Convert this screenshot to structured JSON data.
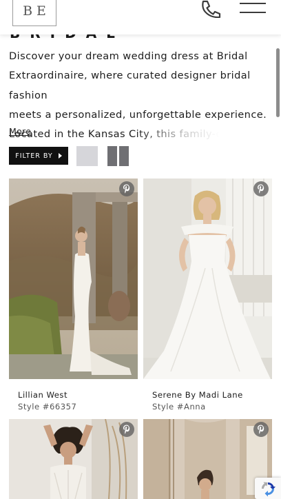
{
  "header": {
    "logo_text": "BE",
    "phone_icon": "phone-icon",
    "menu_icon": "hamburger-menu-icon"
  },
  "page": {
    "heading": "BRIDAL DRESSES",
    "intro_lines": [
      "Discover your dream wedding dress at Bridal",
      "Extraordinaire, where curated designer bridal fashion",
      "meets a personalized, unforgettable experience.",
      "Located in the Kansas City, this family-own"
    ],
    "more_label": "More"
  },
  "filters": {
    "filter_label": "FILTER BY",
    "view_single_icon": "single-column-view-icon",
    "view_double_icon": "two-column-view-icon"
  },
  "products": [
    {
      "name": "Lillian West",
      "style": "Style #66357",
      "pin_icon": "pinterest-icon"
    },
    {
      "name": "Serene By Madi Lane",
      "style": "Style #Anna",
      "pin_icon": "pinterest-icon"
    },
    {
      "name": "",
      "style": "",
      "pin_icon": "pinterest-icon"
    },
    {
      "name": "",
      "style": "",
      "pin_icon": "pinterest-icon"
    }
  ],
  "colors": {
    "filter_button_bg": "#111111",
    "view_active": "#d6d6da",
    "view_inactive": "#6f6f73",
    "pin_bg": "#5f5f5f"
  }
}
